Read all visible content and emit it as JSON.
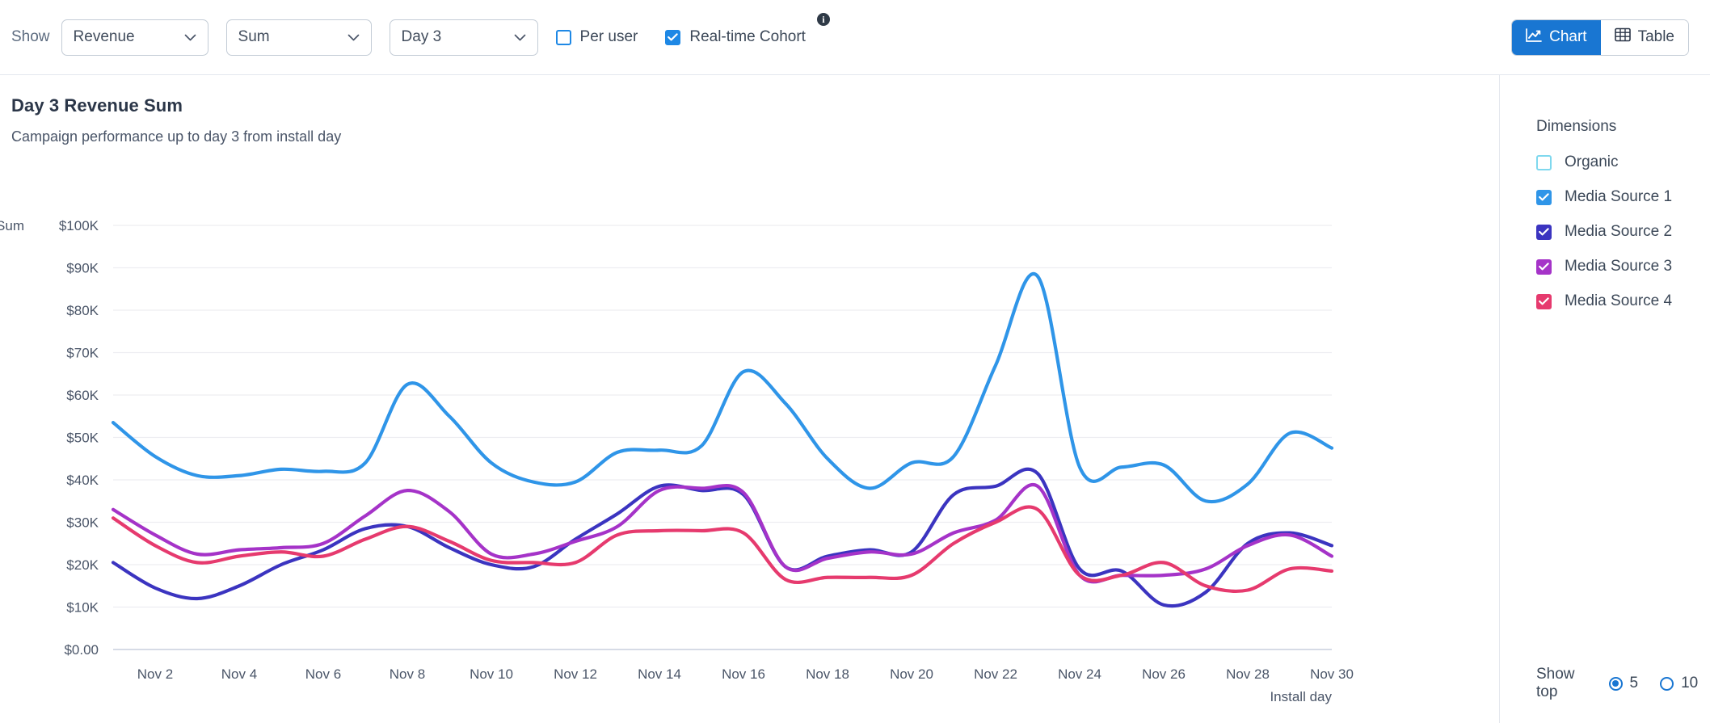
{
  "toolbar": {
    "show_label": "Show",
    "selects": [
      {
        "name": "metric",
        "value": "Revenue"
      },
      {
        "name": "aggregation",
        "value": "Sum"
      },
      {
        "name": "cohort-day",
        "value": "Day 3"
      }
    ],
    "checkboxes": [
      {
        "name": "per-user",
        "label": "Per user",
        "checked": false
      },
      {
        "name": "real-time-cohort",
        "label": "Real-time Cohort",
        "checked": true
      }
    ],
    "info_glyph": "i",
    "view_toggle": [
      {
        "name": "chart",
        "label": "Chart",
        "active": true
      },
      {
        "name": "table",
        "label": "Table",
        "active": false
      }
    ]
  },
  "chart_header": {
    "title": "Day 3 Revenue Sum",
    "subtitle": "Campaign performance up to day 3 from install day"
  },
  "sidebar": {
    "title": "Dimensions",
    "items": [
      {
        "label": "Organic",
        "checked": false,
        "color": "#7fd8ee"
      },
      {
        "label": "Media Source 1",
        "checked": true,
        "color": "#2f95e8"
      },
      {
        "label": "Media Source 2",
        "checked": true,
        "color": "#3b34c0"
      },
      {
        "label": "Media Source 3",
        "checked": true,
        "color": "#a533c8"
      },
      {
        "label": "Media Source 4",
        "checked": true,
        "color": "#e63a6e"
      }
    ],
    "show_top": {
      "label": "Show top",
      "options": [
        {
          "value": "5",
          "selected": true
        },
        {
          "value": "10",
          "selected": false
        }
      ]
    }
  },
  "chart_data": {
    "type": "line",
    "title": "Day 3 Revenue Sum",
    "subtitle": "Campaign performance up to day 3 from install day",
    "xlabel": "Install day",
    "ylabel": "Sum",
    "ylim": [
      0,
      100000
    ],
    "grid": true,
    "legend_position": "right",
    "y_ticks": [
      0,
      10000,
      20000,
      30000,
      40000,
      50000,
      60000,
      70000,
      80000,
      90000,
      100000
    ],
    "y_tick_labels": [
      "$0.00",
      "$10K",
      "$20K",
      "$30K",
      "$40K",
      "$50K",
      "$60K",
      "$70K",
      "$80K",
      "$90K",
      "$100K"
    ],
    "x": [
      "Nov 1",
      "Nov 2",
      "Nov 3",
      "Nov 4",
      "Nov 5",
      "Nov 6",
      "Nov 7",
      "Nov 8",
      "Nov 9",
      "Nov 10",
      "Nov 11",
      "Nov 12",
      "Nov 13",
      "Nov 14",
      "Nov 15",
      "Nov 16",
      "Nov 17",
      "Nov 18",
      "Nov 19",
      "Nov 20",
      "Nov 21",
      "Nov 22",
      "Nov 23",
      "Nov 24",
      "Nov 25",
      "Nov 26",
      "Nov 27",
      "Nov 28",
      "Nov 29",
      "Nov 30"
    ],
    "x_tick_labels": [
      "Nov 2",
      "Nov 4",
      "Nov 6",
      "Nov 8",
      "Nov 10",
      "Nov 12",
      "Nov 14",
      "Nov 16",
      "Nov 18",
      "Nov 20",
      "Nov 22",
      "Nov 24",
      "Nov 26",
      "Nov 28",
      "Nov 30"
    ],
    "series": [
      {
        "name": "Media Source 1",
        "color": "#2f95e8",
        "values": [
          53500,
          45500,
          41000,
          41000,
          42500,
          42000,
          44000,
          62500,
          55000,
          44000,
          39500,
          39500,
          46500,
          47000,
          48000,
          65500,
          58000,
          45000,
          38000,
          44000,
          45500,
          67000,
          88000,
          43000,
          43000,
          43500,
          35000,
          39000,
          51000,
          47500
        ]
      },
      {
        "name": "Media Source 2",
        "color": "#3b34c0",
        "values": [
          20500,
          14500,
          12000,
          15000,
          20000,
          23500,
          28500,
          29000,
          24000,
          20000,
          19500,
          26000,
          32000,
          38500,
          37500,
          36500,
          19500,
          22000,
          23500,
          23000,
          36500,
          38500,
          41500,
          19000,
          18500,
          10500,
          13500,
          25000,
          27500,
          24500
        ]
      },
      {
        "name": "Media Source 3",
        "color": "#a533c8",
        "values": [
          33000,
          27000,
          22500,
          23500,
          24000,
          25000,
          31500,
          37500,
          32500,
          22500,
          22500,
          25500,
          29000,
          37500,
          38000,
          37000,
          19500,
          21500,
          23000,
          22500,
          27500,
          30500,
          38500,
          17500,
          17500,
          17500,
          19000,
          24500,
          27000,
          22000
        ]
      },
      {
        "name": "Media Source 4",
        "color": "#e63a6e",
        "values": [
          31000,
          24500,
          20500,
          22000,
          23000,
          22000,
          26000,
          29000,
          25500,
          21000,
          20500,
          20500,
          27000,
          28000,
          28000,
          27500,
          16500,
          17000,
          17000,
          17500,
          25000,
          30000,
          33000,
          17500,
          17500,
          20500,
          15000,
          14000,
          19000,
          18500
        ]
      }
    ]
  }
}
